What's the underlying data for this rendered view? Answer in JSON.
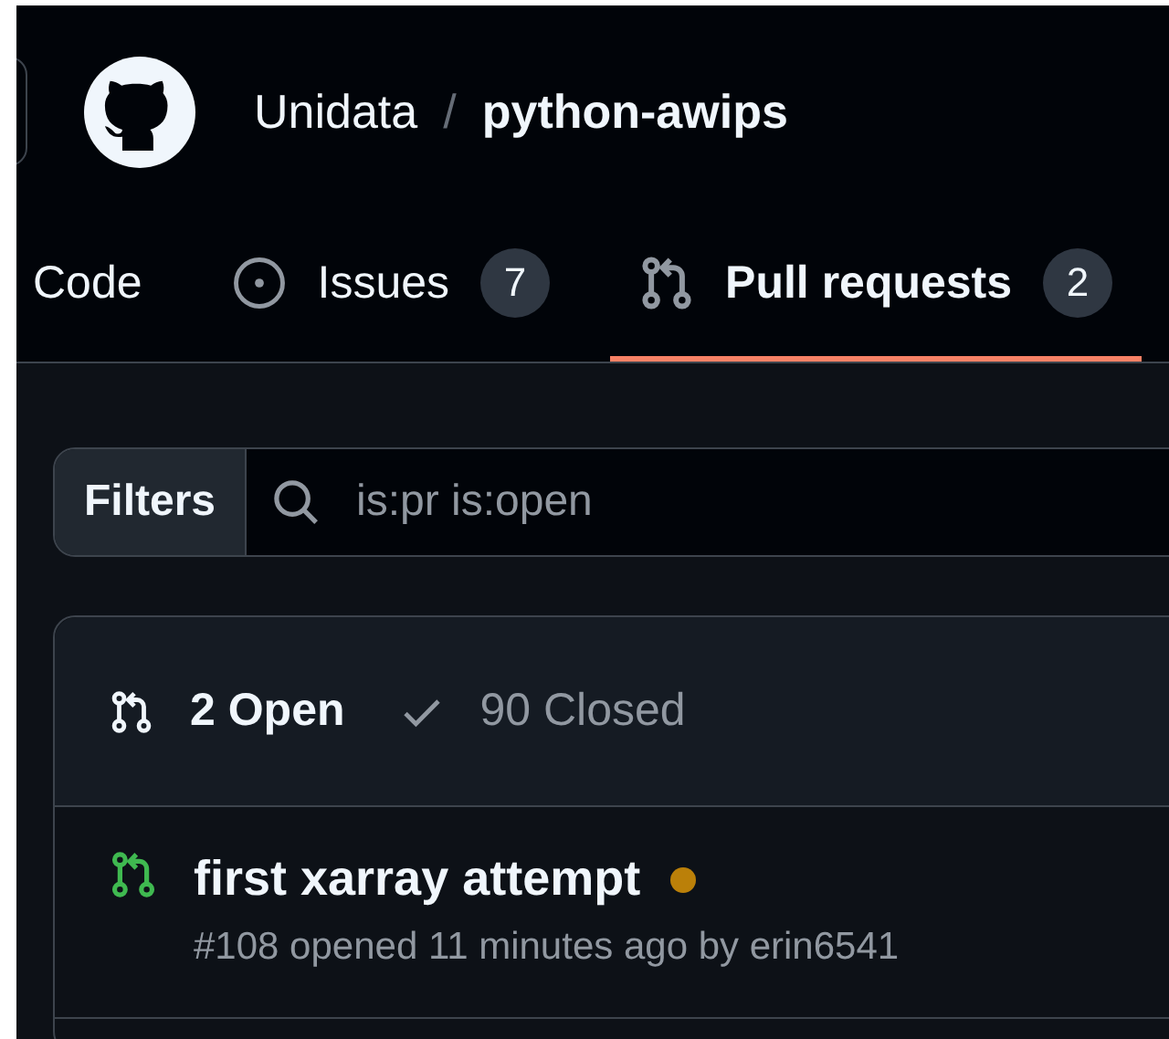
{
  "header": {
    "owner": "Unidata",
    "separator": "/",
    "repo": "python-awips"
  },
  "tabs": [
    {
      "kind": "code",
      "label": "Code",
      "selected": false
    },
    {
      "kind": "issues",
      "label": "Issues",
      "count": "7",
      "selected": false
    },
    {
      "kind": "pulls",
      "label": "Pull requests",
      "count": "2",
      "selected": true
    }
  ],
  "search": {
    "filters_label": "Filters",
    "value": "is:pr is:open"
  },
  "list": {
    "states": [
      {
        "kind": "open",
        "label": "2 Open",
        "selected": true
      },
      {
        "kind": "closed",
        "label": "90 Closed",
        "selected": false
      }
    ],
    "items": [
      {
        "title": "first xarray attempt",
        "color": "#bb8009",
        "meta": "#108 opened 11 minutes ago by erin6541"
      }
    ]
  }
}
